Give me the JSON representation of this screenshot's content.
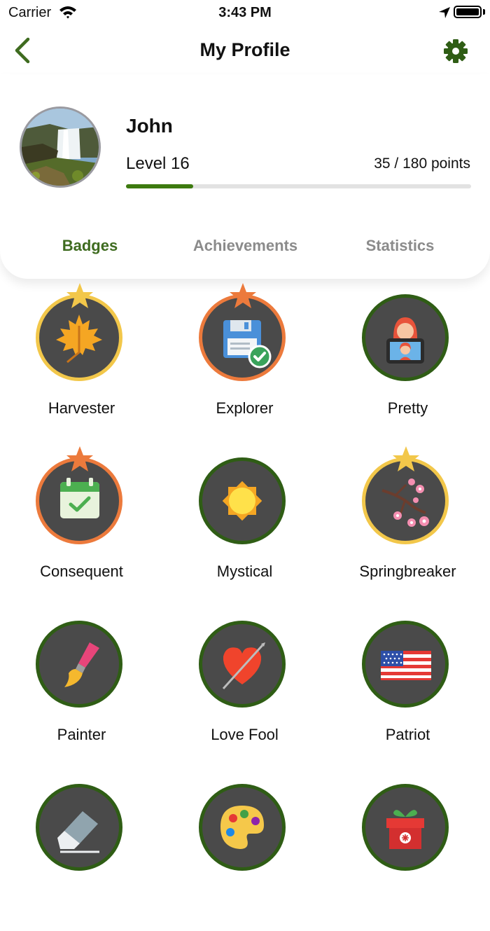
{
  "status_bar": {
    "carrier": "Carrier",
    "time": "3:43 PM"
  },
  "nav": {
    "title": "My Profile",
    "back_icon": "chevron-left-icon",
    "settings_icon": "gear-icon"
  },
  "profile": {
    "name": "John",
    "level": "Level 16",
    "points": "35 / 180 points",
    "progress": 0.194
  },
  "tabs": [
    {
      "label": "Badges",
      "active": true
    },
    {
      "label": "Achievements",
      "active": false
    },
    {
      "label": "Statistics",
      "active": false
    }
  ],
  "badges": [
    {
      "label": "Harvester",
      "icon": "maple-leaf-icon",
      "ring": "gold",
      "star": true
    },
    {
      "label": "Explorer",
      "icon": "floppy-disk-check-icon",
      "ring": "orange",
      "star": true
    },
    {
      "label": "Pretty",
      "icon": "selfie-phone-icon",
      "ring": "green",
      "star": false
    },
    {
      "label": "Consequent",
      "icon": "calendar-check-icon",
      "ring": "orange",
      "star": true
    },
    {
      "label": "Mystical",
      "icon": "sun-icon",
      "ring": "green",
      "star": false
    },
    {
      "label": "Springbreaker",
      "icon": "cherry-blossom-icon",
      "ring": "gold",
      "star": true
    },
    {
      "label": "Painter",
      "icon": "paintbrush-icon",
      "ring": "green",
      "star": false
    },
    {
      "label": "Love Fool",
      "icon": "heart-arrow-icon",
      "ring": "green",
      "star": false
    },
    {
      "label": "Patriot",
      "icon": "us-flag-icon",
      "ring": "green",
      "star": false
    },
    {
      "label": "",
      "icon": "eraser-icon",
      "ring": "green",
      "star": false
    },
    {
      "label": "",
      "icon": "palette-icon",
      "ring": "green",
      "star": false
    },
    {
      "label": "",
      "icon": "gift-icon",
      "ring": "green",
      "star": false
    }
  ],
  "colors": {
    "accent_green": "#3e6b1f",
    "progress_green": "#3d7a0f",
    "ring_green": "#2f5d15",
    "ring_gold": "#f2c74a",
    "ring_orange": "#ec7a3c",
    "badge_bg": "#4a4a4a"
  }
}
